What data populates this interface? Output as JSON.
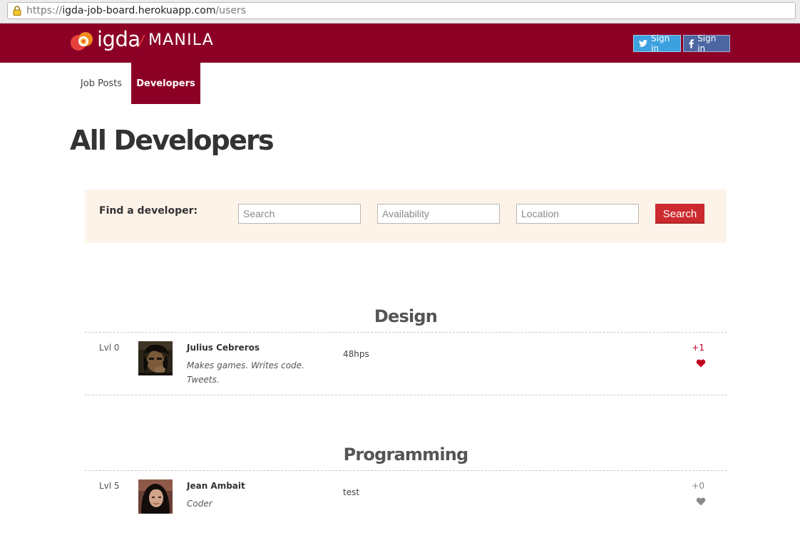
{
  "browser": {
    "url_protocol": "https://",
    "url_domain": "igda-job-board.herokuapp.com",
    "url_path": "/users"
  },
  "header": {
    "logo_text": "igda",
    "logo_separator": "/",
    "logo_city": "MANILA",
    "twitter_signin": "Sign in",
    "facebook_signin": "Sign in",
    "colors": {
      "brand": "#8c0026",
      "twitter": "#3da1e0",
      "facebook": "#4c66a2",
      "accent": "#cc2a2f"
    }
  },
  "nav": {
    "items": [
      {
        "label": "Job Posts",
        "active": false
      },
      {
        "label": "Developers",
        "active": true
      }
    ]
  },
  "page": {
    "title": "All Developers"
  },
  "search": {
    "label": "Find a developer:",
    "search_placeholder": "Search",
    "availability_placeholder": "Availability",
    "location_placeholder": "Location",
    "button_label": "Search"
  },
  "sections": [
    {
      "title": "Design",
      "developers": [
        {
          "level": "Lvl 0",
          "name": "Julius Cebreros",
          "bio": "Makes games. Writes code. Tweets.",
          "studio": "48hps",
          "votes": "+1",
          "liked": true
        }
      ]
    },
    {
      "title": "Programming",
      "developers": [
        {
          "level": "Lvl 5",
          "name": "Jean Ambait",
          "bio": "Coder",
          "studio": "test",
          "votes": "+0",
          "liked": false
        }
      ]
    }
  ]
}
